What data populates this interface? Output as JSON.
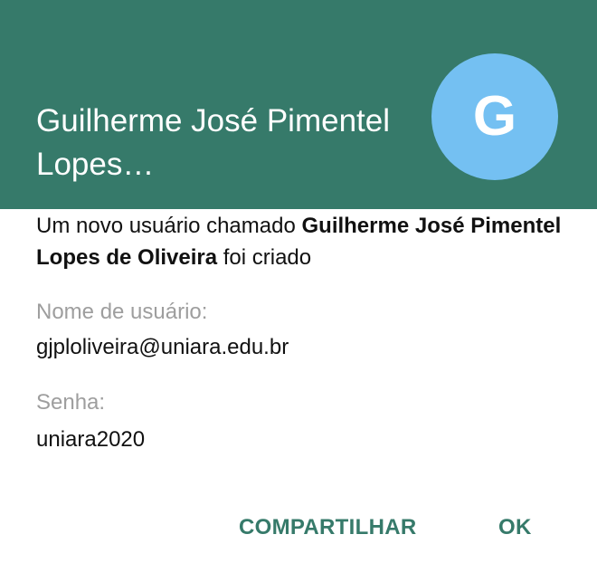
{
  "dialog": {
    "title": "Guilherme José Pimentel Lopes…",
    "avatar_letter": "G",
    "message": {
      "prefix": "Um novo usuário chamado ",
      "name": "Guilherme José Pimentel Lopes de Oliveira",
      "suffix": " foi criado"
    },
    "username": {
      "label": "Nome de usuário:",
      "value": "gjploliveira@uniara.edu.br"
    },
    "password": {
      "label": "Senha:",
      "value": "uniara2020"
    },
    "actions": {
      "share_label": "COMPARTILHAR",
      "ok_label": "OK"
    }
  },
  "colors": {
    "header": "#367a6a",
    "avatar": "#74c0f2",
    "accent": "#367a6a",
    "label": "#9e9e9e"
  }
}
